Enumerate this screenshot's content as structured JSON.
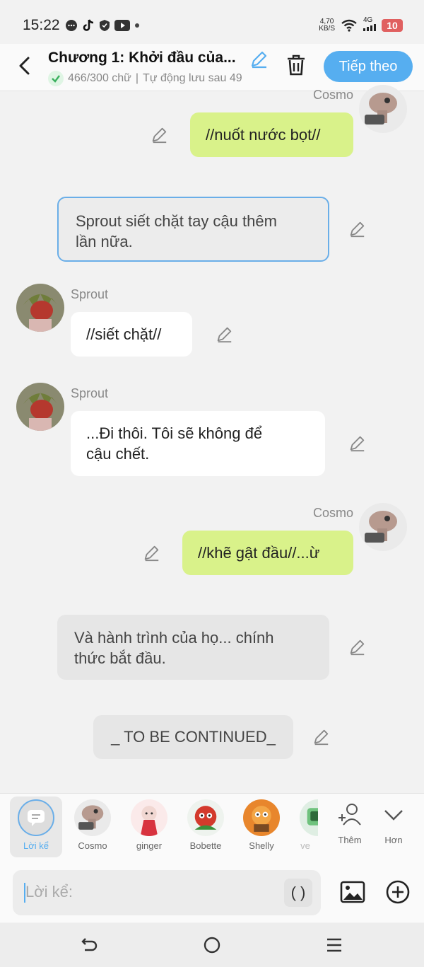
{
  "status_bar": {
    "time": "15:22",
    "network_speed_top": "4,70",
    "network_speed_unit": "KB/S",
    "signal_label": "4G",
    "battery": "10"
  },
  "header": {
    "title": "Chương 1: Khởi đầu của...",
    "word_count": "466/300 chữ",
    "autosave": "Tự động lưu sau 49",
    "next_button": "Tiếp theo"
  },
  "messages": [
    {
      "type": "right",
      "name": "Cosmo",
      "text": "//nuốt nước bọt//",
      "avatar": "cosmo-avatar"
    },
    {
      "type": "narration",
      "text_line1": "Sprout siết chặt tay cậu thêm",
      "text_line2": "lần nữa."
    },
    {
      "type": "left",
      "name": "Sprout",
      "text": "//siết chặt//",
      "avatar": "sprout-avatar"
    },
    {
      "type": "left",
      "name": "Sprout",
      "text_line1": "...Đi thôi. Tôi sẽ không để",
      "text_line2": "cậu chết.",
      "avatar": "sprout-avatar"
    },
    {
      "type": "right",
      "name": "Cosmo",
      "text": "//khẽ gật đầu//...ừ",
      "avatar": "cosmo-avatar"
    },
    {
      "type": "narration",
      "text_line1": "Và hành trình của họ... chính",
      "text_line2": "thức bắt đầu."
    },
    {
      "type": "narration",
      "text": "_ TO BE CONTINUED_"
    }
  ],
  "characters": [
    {
      "label": "Lời kể",
      "icon": "narration-icon"
    },
    {
      "label": "Cosmo",
      "icon": "cosmo-avatar"
    },
    {
      "label": "ginger",
      "icon": "ginger-avatar"
    },
    {
      "label": "Bobette",
      "icon": "bobette-avatar"
    },
    {
      "label": "Shelly",
      "icon": "shelly-avatar"
    },
    {
      "label": "ve",
      "icon": "ve-avatar"
    }
  ],
  "char_actions": {
    "add": "Thêm",
    "more": "Hơn"
  },
  "input": {
    "placeholder": "Lời kể:",
    "paren_button": "( )"
  },
  "colors": {
    "accent": "#56aef0",
    "green_bubble": "#d9f28a",
    "selected_border": "#6aaee8"
  }
}
